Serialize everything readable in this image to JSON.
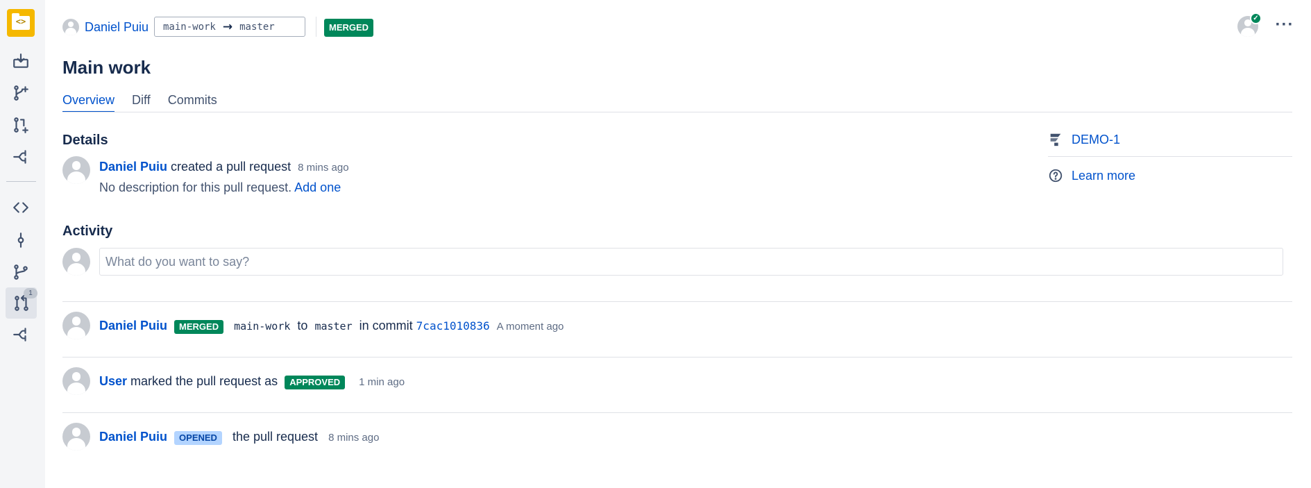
{
  "sidebar": {
    "logo_glyph": "<>",
    "pr_badge": "1",
    "icons": [
      "clone-icon",
      "create-branch-icon",
      "create-pull-request-icon",
      "fork-icon",
      "source-icon",
      "commits-icon",
      "branches-icon",
      "pull-requests-icon",
      "forks-icon"
    ]
  },
  "header": {
    "author": "Daniel Puiu",
    "source_branch": "main-work",
    "arrow": "→",
    "target_branch": "master",
    "status": "MERGED",
    "more": "···"
  },
  "title": "Main work",
  "tabs": [
    {
      "label": "Overview",
      "active": true
    },
    {
      "label": "Diff",
      "active": false
    },
    {
      "label": "Commits",
      "active": false
    }
  ],
  "details": {
    "heading": "Details",
    "author": "Daniel Puiu",
    "action": "created a pull request",
    "time": "8 mins ago",
    "description": "No description for this pull request.",
    "add_link": "Add one"
  },
  "activity": {
    "heading": "Activity",
    "placeholder": "What do you want to say?",
    "events": [
      {
        "user": "Daniel Puiu",
        "badge": "MERGED",
        "source": "main-work",
        "to": "to",
        "target": "master",
        "in_commit": "in commit",
        "commit": "7cac1010836",
        "time": "A moment ago"
      },
      {
        "user": "User",
        "text": "marked the pull request as",
        "badge": "APPROVED",
        "time": "1 min ago"
      },
      {
        "user": "Daniel Puiu",
        "badge": "OPENED",
        "text": "the pull request",
        "time": "8 mins ago"
      }
    ]
  },
  "right_panel": {
    "issue": "DEMO-1",
    "learn_more": "Learn more"
  },
  "colors": {
    "accent": "#0052cc",
    "merged": "#00875a",
    "opened": "#b3d4ff",
    "logo": "#f5b800"
  }
}
